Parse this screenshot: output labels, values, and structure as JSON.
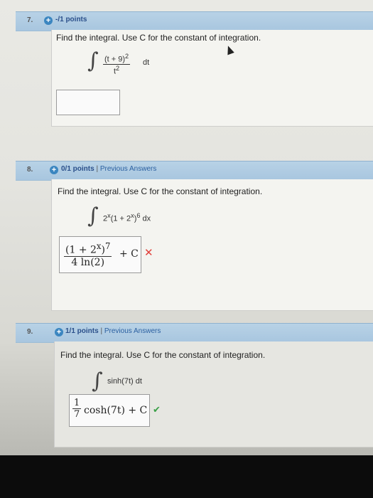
{
  "questions": [
    {
      "number": "7.",
      "points": "-/1 points",
      "prompt": "Find the integral. Use C for the constant of integration.",
      "integrand_numerator": "(t + 9)",
      "integrand_numerator_exp": "2",
      "integrand_denominator": "t",
      "integrand_denominator_exp": "2",
      "differential": "dt",
      "answer": ""
    },
    {
      "number": "8.",
      "points": "0/1 points",
      "separator": "|",
      "previous_answers": "Previous Answers",
      "prompt": "Find the integral. Use C for the constant of integration.",
      "integrand": "2",
      "integrand_exp": "x",
      "integrand_rest": "(1 + 2",
      "integrand_rest_exp": "x",
      "integrand_close": ")",
      "integrand_power": "6",
      "differential": "dx",
      "answer_numerator": "(1 + 2",
      "answer_numerator_exp": "x",
      "answer_numerator_close": ")",
      "answer_numerator_power": "7",
      "answer_denominator": "4 ln(2)",
      "answer_constant": "+ C",
      "result": "incorrect"
    },
    {
      "number": "9.",
      "points": "1/1 points",
      "separator": "|",
      "previous_answers": "Previous Answers",
      "prompt": "Find the integral. Use C for the constant of integration.",
      "integrand": "sinh(7t)",
      "differential": "dt",
      "answer_frac_num": "1",
      "answer_frac_den": "7",
      "answer_body": "cosh(7t) + C",
      "result": "correct"
    }
  ],
  "colors": {
    "header_bar": "#a8c6df",
    "incorrect": "#e0403b",
    "correct": "#3aa047",
    "link": "#2a5fa0"
  }
}
